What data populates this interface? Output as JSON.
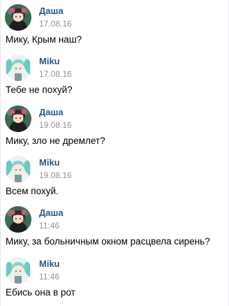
{
  "colors": {
    "author_link": "#2a5885",
    "timestamp": "#939393",
    "message_text": "#000000",
    "background": "#ffffff"
  },
  "messages": [
    {
      "author": "Даша",
      "time": "17.08.16",
      "text": "Мику, Крым наш?",
      "avatar_icon": "dasha-avatar-icon"
    },
    {
      "author": "Miku",
      "time": "17.08.16",
      "text": "Тебе не похуй?",
      "avatar_icon": "miku-avatar-icon"
    },
    {
      "author": "Даша",
      "time": "19.08.16",
      "text": "Мику, зло не дремлет?",
      "avatar_icon": "dasha-avatar-icon"
    },
    {
      "author": "Miku",
      "time": "19.08.16",
      "text": "Всем похуй.",
      "avatar_icon": "miku-avatar-icon"
    },
    {
      "author": "Даша",
      "time": "11:46",
      "text": "Мику, за больничным окном расцвела сирень?",
      "avatar_icon": "dasha-avatar-icon"
    },
    {
      "author": "Miku",
      "time": "11:46",
      "text": "Ебись она в рот",
      "avatar_icon": "miku-avatar-icon"
    }
  ]
}
